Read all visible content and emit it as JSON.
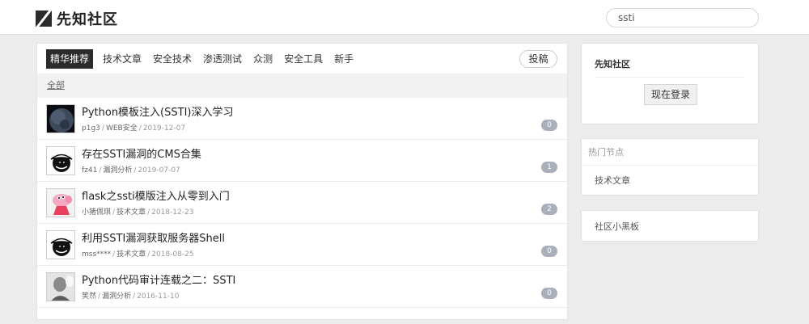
{
  "header": {
    "logo_text": "先知社区",
    "search_value": "ssti"
  },
  "tabs": [
    {
      "label": "精华推荐",
      "active": true
    },
    {
      "label": "技术文章"
    },
    {
      "label": "安全技术"
    },
    {
      "label": "渗透测试"
    },
    {
      "label": "众测"
    },
    {
      "label": "安全工具"
    },
    {
      "label": "新手"
    }
  ],
  "post_button": "投稿",
  "filter": "全部",
  "posts": [
    {
      "title": "Python模板注入(SSTI)深入学习",
      "author": "p1g3",
      "category": "WEB安全",
      "date": "2019-12-07",
      "count": "0",
      "avatar": "planet"
    },
    {
      "title": "存在SSTI漏洞的CMS合集",
      "author": "fz41",
      "category": "漏洞分析",
      "date": "2019-07-07",
      "count": "1",
      "avatar": "hat-sketch"
    },
    {
      "title": "flask之ssti模版注入从零到入门",
      "author": "小猪佩琪",
      "category": "技术文章",
      "date": "2018-12-23",
      "count": "2",
      "avatar": "peppa-pig"
    },
    {
      "title": "利用SSTI漏洞获取服务器Shell",
      "author": "mss****",
      "category": "技术文章",
      "date": "2018-08-25",
      "count": "0",
      "avatar": "hat-sketch"
    },
    {
      "title": "Python代码审计连载之二：SSTI",
      "author": "笑然",
      "category": "漏洞分析",
      "date": "2016-11-10",
      "count": "0",
      "avatar": "portrait"
    }
  ],
  "sidebar": {
    "community_title": "先知社区",
    "login_button": "现在登录",
    "hot_header": "热门节点",
    "hot_items": [
      "技术文章"
    ],
    "blackboard": "社区小黑板"
  }
}
